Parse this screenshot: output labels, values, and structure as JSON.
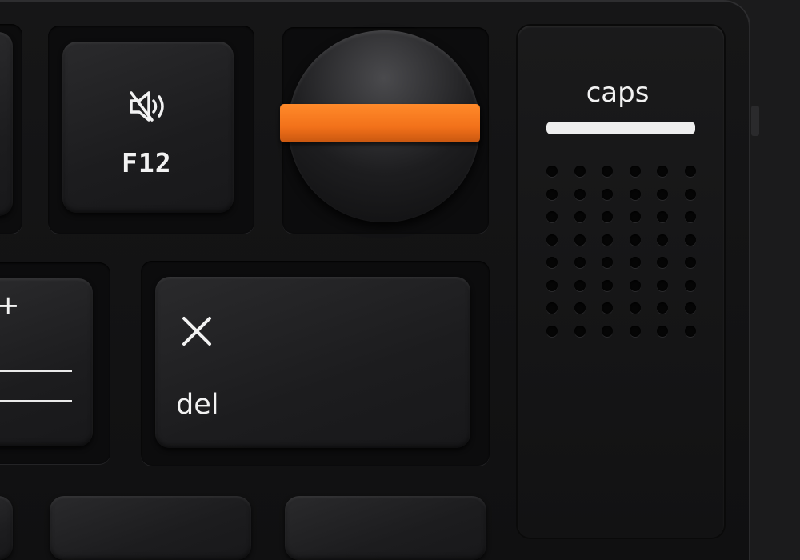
{
  "keys": {
    "f12": {
      "icon": "speaker-mute-icon",
      "label": "F12"
    },
    "delete": {
      "icon": "close-icon",
      "label": "del"
    },
    "plus": {
      "label": "+"
    }
  },
  "knob": {
    "accent_color": "#f2711a"
  },
  "caps_panel": {
    "label": "caps"
  }
}
